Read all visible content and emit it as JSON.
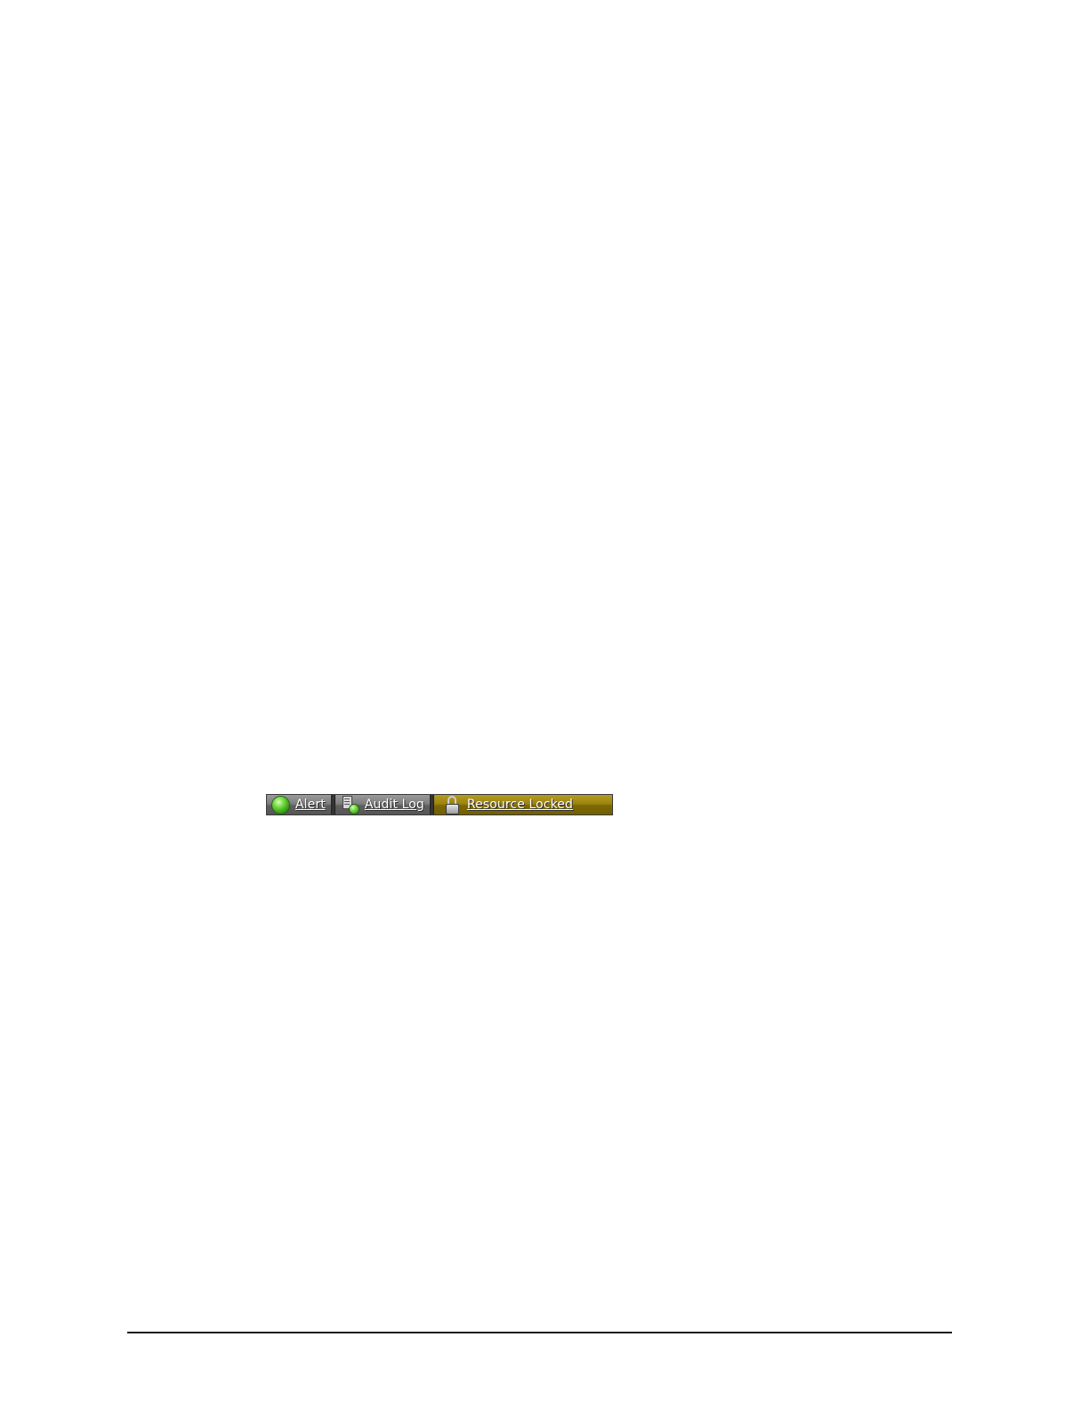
{
  "statusbar": {
    "items": [
      {
        "label": "Alert",
        "icon": "green-status-orb-icon"
      },
      {
        "label": "Audit Log",
        "icon": "document-with-green-dot-icon"
      },
      {
        "label": "Resource Locked",
        "icon": "padlock-icon",
        "highlight_color": "#9c8410"
      }
    ]
  }
}
